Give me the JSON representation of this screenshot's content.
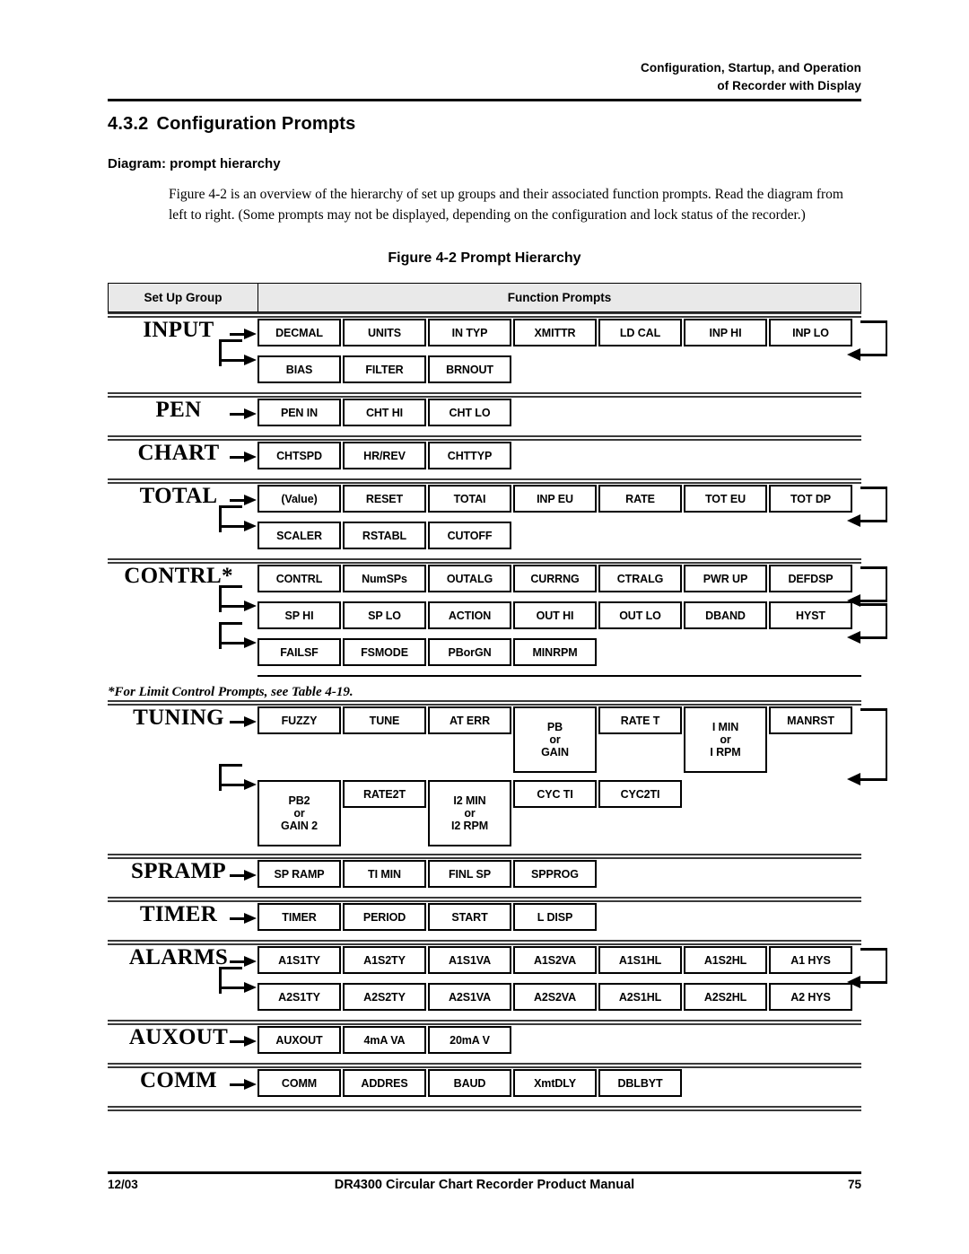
{
  "running_head": {
    "line1": "Configuration, Startup, and Operation",
    "line2": "of Recorder with Display"
  },
  "section": {
    "number": "4.3.2",
    "title": "Configuration Prompts",
    "subheading": "Diagram: prompt hierarchy",
    "body": "Figure 4-2 is an overview of the hierarchy of set up groups and their associated function prompts. Read the diagram from left to right. (Some prompts may not be displayed, depending on the configuration and lock status of the recorder.)"
  },
  "figure": {
    "title": "Figure 4-2  Prompt Hierarchy",
    "columns": {
      "setup_group": "Set Up Group",
      "function_prompts": "Function Prompts"
    },
    "footnote": "*For Limit Control Prompts, see Table 4-19.",
    "groups": [
      {
        "label": "INPUT",
        "rows": [
          {
            "entry": "arrow",
            "wrap": true,
            "boxes": [
              "DECMAL",
              "UNITS",
              "IN TYP",
              "XMITTR",
              "LD CAL",
              "INP HI",
              "INP LO"
            ]
          },
          {
            "entry": "elbow",
            "wrap": false,
            "boxes": [
              "BIAS",
              "FILTER",
              "BRNOUT"
            ]
          }
        ]
      },
      {
        "label": "PEN",
        "rows": [
          {
            "entry": "arrow",
            "wrap": false,
            "boxes": [
              "PEN IN",
              "CHT HI",
              "CHT LO"
            ]
          }
        ]
      },
      {
        "label": "CHART",
        "rows": [
          {
            "entry": "arrow",
            "wrap": false,
            "boxes": [
              "CHTSPD",
              "HR/REV",
              "CHTTYP"
            ]
          }
        ]
      },
      {
        "label": "TOTAL",
        "rows": [
          {
            "entry": "arrow",
            "wrap": true,
            "boxes": [
              "(Value)",
              "RESET",
              "TOTAI",
              "INP EU",
              "RATE",
              "TOT EU",
              "TOT DP"
            ]
          },
          {
            "entry": "elbow",
            "wrap": false,
            "boxes": [
              "SCALER",
              "RSTABL",
              "CUTOFF"
            ]
          }
        ]
      },
      {
        "label": "CONTRL*",
        "rows": [
          {
            "entry": "none",
            "wrap": true,
            "boxes": [
              "CONTRL",
              "NumSPs",
              "OUTALG",
              "CURRNG",
              "CTRALG",
              "PWR UP",
              "DEFDSP"
            ]
          },
          {
            "entry": "elbow",
            "wrap": true,
            "boxes": [
              "SP HI",
              "SP LO",
              "ACTION",
              "OUT HI",
              "OUT LO",
              "DBAND",
              "HYST"
            ]
          },
          {
            "entry": "elbow",
            "wrap": false,
            "boxes": [
              "FAILSF",
              "FSMODE",
              "PBorGN",
              "MINRPM"
            ]
          }
        ]
      },
      {
        "label": "TUNING",
        "rows": [
          {
            "entry": "arrow",
            "wrap": true,
            "tall": true,
            "boxes": [
              "FUZZY",
              "TUNE",
              "AT ERR",
              "PB\nor\nGAIN",
              "RATE T",
              "I MIN\nor\nI RPM",
              "MANRST"
            ],
            "tall_indexes": [
              3,
              5
            ]
          },
          {
            "entry": "elbow",
            "wrap": false,
            "tall": true,
            "boxes": [
              "PB2\nor\nGAIN 2",
              "RATE2T",
              "I2 MIN\nor\nI2 RPM",
              "CYC TI",
              "CYC2TI"
            ],
            "tall_indexes": [
              0,
              2
            ]
          }
        ]
      },
      {
        "label": "SPRAMP",
        "rows": [
          {
            "entry": "arrow",
            "wrap": false,
            "boxes": [
              "SP RAMP",
              "TI MIN",
              "FINL SP",
              "SPPROG"
            ]
          }
        ]
      },
      {
        "label": "TIMER",
        "rows": [
          {
            "entry": "arrow",
            "wrap": false,
            "boxes": [
              "TIMER",
              "PERIOD",
              "START",
              "L DISP"
            ]
          }
        ]
      },
      {
        "label": "ALARMS",
        "rows": [
          {
            "entry": "arrow",
            "wrap": true,
            "boxes": [
              "A1S1TY",
              "A1S2TY",
              "A1S1VA",
              "A1S2VA",
              "A1S1HL",
              "A1S2HL",
              "A1 HYS"
            ]
          },
          {
            "entry": "elbow",
            "wrap": false,
            "boxes": [
              "A2S1TY",
              "A2S2TY",
              "A2S1VA",
              "A2S2VA",
              "A2S1HL",
              "A2S2HL",
              "A2 HYS"
            ]
          }
        ]
      },
      {
        "label": "AUXOUT",
        "rows": [
          {
            "entry": "arrow",
            "wrap": false,
            "boxes": [
              "AUXOUT",
              "4mA VA",
              "20mA V"
            ]
          }
        ]
      },
      {
        "label": "COMM",
        "rows": [
          {
            "entry": "arrow",
            "wrap": false,
            "boxes": [
              "COMM",
              "ADDRES",
              "BAUD",
              "XmtDLY",
              "DBLBYT"
            ]
          }
        ]
      }
    ]
  },
  "footer": {
    "date": "12/03",
    "title": "DR4300 Circular Chart Recorder Product Manual",
    "page": "75"
  }
}
